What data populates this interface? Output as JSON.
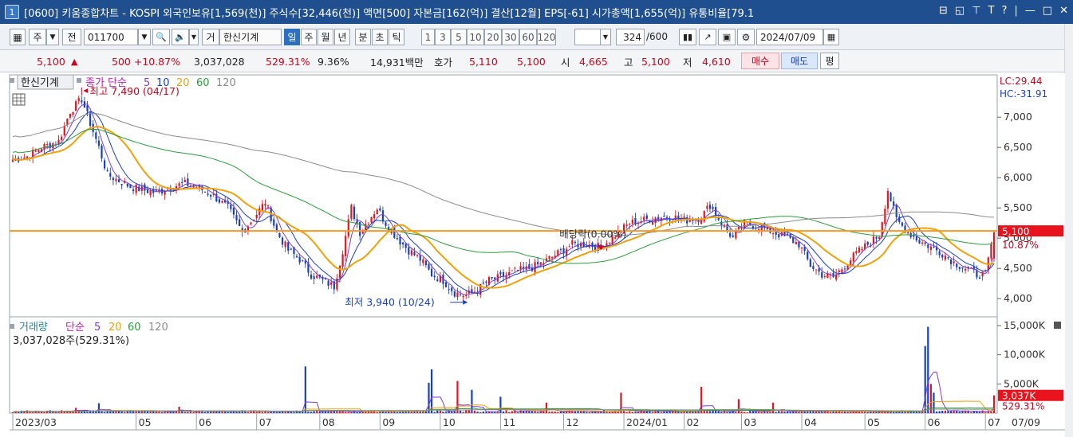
{
  "window": {
    "badge": "1",
    "title": "[0600] 키움종합차트 - KOSPI 외국인보유[1,569(천)] 주식수[32,446(천)] 액면[500] 자본금[162(억)] 결산[12월] EPS[-61] 시가총액[1,655(억)] 유통비율[79.1",
    "controls": [
      "⊟",
      "◱",
      "⊤",
      "T",
      "?",
      "|",
      "—",
      "□",
      "✕"
    ]
  },
  "toolbar": {
    "layout_btn": "▦",
    "period_sel": "주",
    "all_btn": "전",
    "code": "011700",
    "search_icon": "🔍",
    "sound_icon": "🔈",
    "chart_toggle": "거",
    "name": "한신기계",
    "periods": [
      "일",
      "주",
      "월",
      "년",
      "분",
      "초",
      "틱"
    ],
    "selected_period": "일",
    "ticks": [
      "1",
      "3",
      "5",
      "10",
      "20",
      "30",
      "60",
      "120"
    ],
    "count_value": "324",
    "count_total": "/600",
    "date": "2024/07/09"
  },
  "quote": {
    "price": "5,100",
    "arrow": "▲",
    "change": "500 +10.87%",
    "volume": "3,037,028",
    "vol_ratio": "529.31%",
    "turnover": "9.36%",
    "amount": "14,931백만",
    "bid_label": "호가",
    "ask1": "5,110",
    "ask2": "5,100",
    "open_label": "시",
    "open": "4,665",
    "high_label": "고",
    "high": "5,100",
    "low_label": "저",
    "low": "4,610",
    "buy": "매수",
    "sell": "매도",
    "eval": "평"
  },
  "colors": {
    "up": "#e8131c",
    "down": "#1a3fc4",
    "ma5": "#7c3ed0",
    "ma10": "#1a3fc4",
    "ma20": "#f0a10a",
    "ma60": "#2a9d3a",
    "ma120": "#8a8a8a",
    "hline": "#f59a23"
  },
  "chart_data": [
    {
      "type": "candlestick",
      "title": "",
      "legend": {
        "name": "한신기계",
        "caption": "종가 단순",
        "periods": [
          "5",
          "10",
          "20",
          "60",
          "120"
        ]
      },
      "top_right": [
        "LC:29.44",
        "HC:-31.91"
      ],
      "ylim": [
        3700,
        7700
      ],
      "y_ticks": [
        7000,
        6500,
        6000,
        5500,
        5000,
        4500,
        4000
      ],
      "y_tick_labels": [
        "7,000",
        "6,500",
        "6,000",
        "5,500",
        "5,000",
        "4,500",
        "4,000"
      ],
      "x_tick_labels": [
        "2023/03",
        "05",
        "06",
        "07",
        "08",
        "09",
        "10",
        "11",
        "12",
        "2024/01",
        "02",
        "03",
        "04",
        "05",
        "06",
        "07"
      ],
      "x_tick_pos_days": [
        0,
        43,
        64,
        85,
        107,
        128,
        149,
        170,
        192,
        213,
        234,
        254,
        275,
        297,
        318,
        339
      ],
      "current_price_label": "5,100",
      "current_change_label": "10.87%",
      "horizontal_line": 5120,
      "annotations": [
        {
          "text": "최고 7,490 (04/17)",
          "day": 24,
          "value": 7490
        },
        {
          "text": "최저 3,940 (10/24)",
          "day": 158,
          "value": 3940
        },
        {
          "text": "배당락(0.00%)",
          "day": 205,
          "value": 4880
        }
      ],
      "close_anchors": [
        [
          0,
          6300
        ],
        [
          5,
          6350
        ],
        [
          10,
          6500
        ],
        [
          16,
          6600
        ],
        [
          20,
          7100
        ],
        [
          24,
          7300
        ],
        [
          27,
          6900
        ],
        [
          30,
          6500
        ],
        [
          33,
          6050
        ],
        [
          37,
          5950
        ],
        [
          41,
          5850
        ],
        [
          45,
          5800
        ],
        [
          50,
          5750
        ],
        [
          55,
          5850
        ],
        [
          60,
          5900
        ],
        [
          64,
          5850
        ],
        [
          70,
          5700
        ],
        [
          75,
          5500
        ],
        [
          80,
          5100
        ],
        [
          85,
          5400
        ],
        [
          88,
          5600
        ],
        [
          92,
          5100
        ],
        [
          96,
          4800
        ],
        [
          100,
          4650
        ],
        [
          104,
          4400
        ],
        [
          108,
          4300
        ],
        [
          112,
          4200
        ],
        [
          115,
          4800
        ],
        [
          118,
          5500
        ],
        [
          121,
          5100
        ],
        [
          124,
          5300
        ],
        [
          127,
          5500
        ],
        [
          130,
          5250
        ],
        [
          134,
          5000
        ],
        [
          138,
          4800
        ],
        [
          142,
          4650
        ],
        [
          146,
          4400
        ],
        [
          150,
          4300
        ],
        [
          154,
          4100
        ],
        [
          158,
          4050
        ],
        [
          162,
          4150
        ],
        [
          166,
          4300
        ],
        [
          170,
          4350
        ],
        [
          175,
          4450
        ],
        [
          180,
          4500
        ],
        [
          185,
          4600
        ],
        [
          190,
          4750
        ],
        [
          195,
          4900
        ],
        [
          200,
          4900
        ],
        [
          205,
          4850
        ],
        [
          210,
          5050
        ],
        [
          215,
          5250
        ],
        [
          220,
          5300
        ],
        [
          225,
          5350
        ],
        [
          230,
          5350
        ],
        [
          235,
          5300
        ],
        [
          240,
          5350
        ],
        [
          243,
          5550
        ],
        [
          247,
          5250
        ],
        [
          251,
          5000
        ],
        [
          255,
          5250
        ],
        [
          260,
          5200
        ],
        [
          265,
          5100
        ],
        [
          270,
          5000
        ],
        [
          274,
          4900
        ],
        [
          278,
          4550
        ],
        [
          282,
          4400
        ],
        [
          286,
          4350
        ],
        [
          290,
          4550
        ],
        [
          294,
          4750
        ],
        [
          298,
          4900
        ],
        [
          302,
          5050
        ],
        [
          305,
          5800
        ],
        [
          308,
          5300
        ],
        [
          312,
          5100
        ],
        [
          316,
          4950
        ],
        [
          320,
          4850
        ],
        [
          324,
          4750
        ],
        [
          328,
          4600
        ],
        [
          332,
          4500
        ],
        [
          336,
          4400
        ],
        [
          339,
          4400
        ],
        [
          342,
          5100
        ]
      ],
      "series": [
        {
          "name": "5"
        },
        {
          "name": "10"
        },
        {
          "name": "20"
        },
        {
          "name": "60"
        },
        {
          "name": "120"
        }
      ]
    },
    {
      "type": "bar",
      "title": "",
      "legend": {
        "name": "거래량",
        "caption": "단순",
        "periods": [
          "5",
          "20",
          "60",
          "120"
        ]
      },
      "summary": "3,037,028주(529.31%)",
      "ylim": [
        0,
        16500
      ],
      "y_ticks": [
        15000,
        10000,
        5000
      ],
      "y_tick_labels": [
        "15,000K",
        "10,000K",
        "5,000K"
      ],
      "current_label": "3,037K",
      "current_ratio": "529.31%",
      "spikes": [
        [
          22,
          900
        ],
        [
          30,
          1700
        ],
        [
          58,
          1100
        ],
        [
          102,
          8000
        ],
        [
          145,
          5200
        ],
        [
          146,
          7500
        ],
        [
          155,
          5500
        ],
        [
          160,
          4000
        ],
        [
          170,
          2800
        ],
        [
          186,
          1800
        ],
        [
          212,
          3500
        ],
        [
          240,
          4500
        ],
        [
          253,
          2400
        ],
        [
          265,
          1800
        ],
        [
          318,
          11500
        ],
        [
          319,
          14800
        ],
        [
          320,
          5000
        ],
        [
          321,
          3500
        ],
        [
          342,
          3037
        ]
      ]
    }
  ]
}
